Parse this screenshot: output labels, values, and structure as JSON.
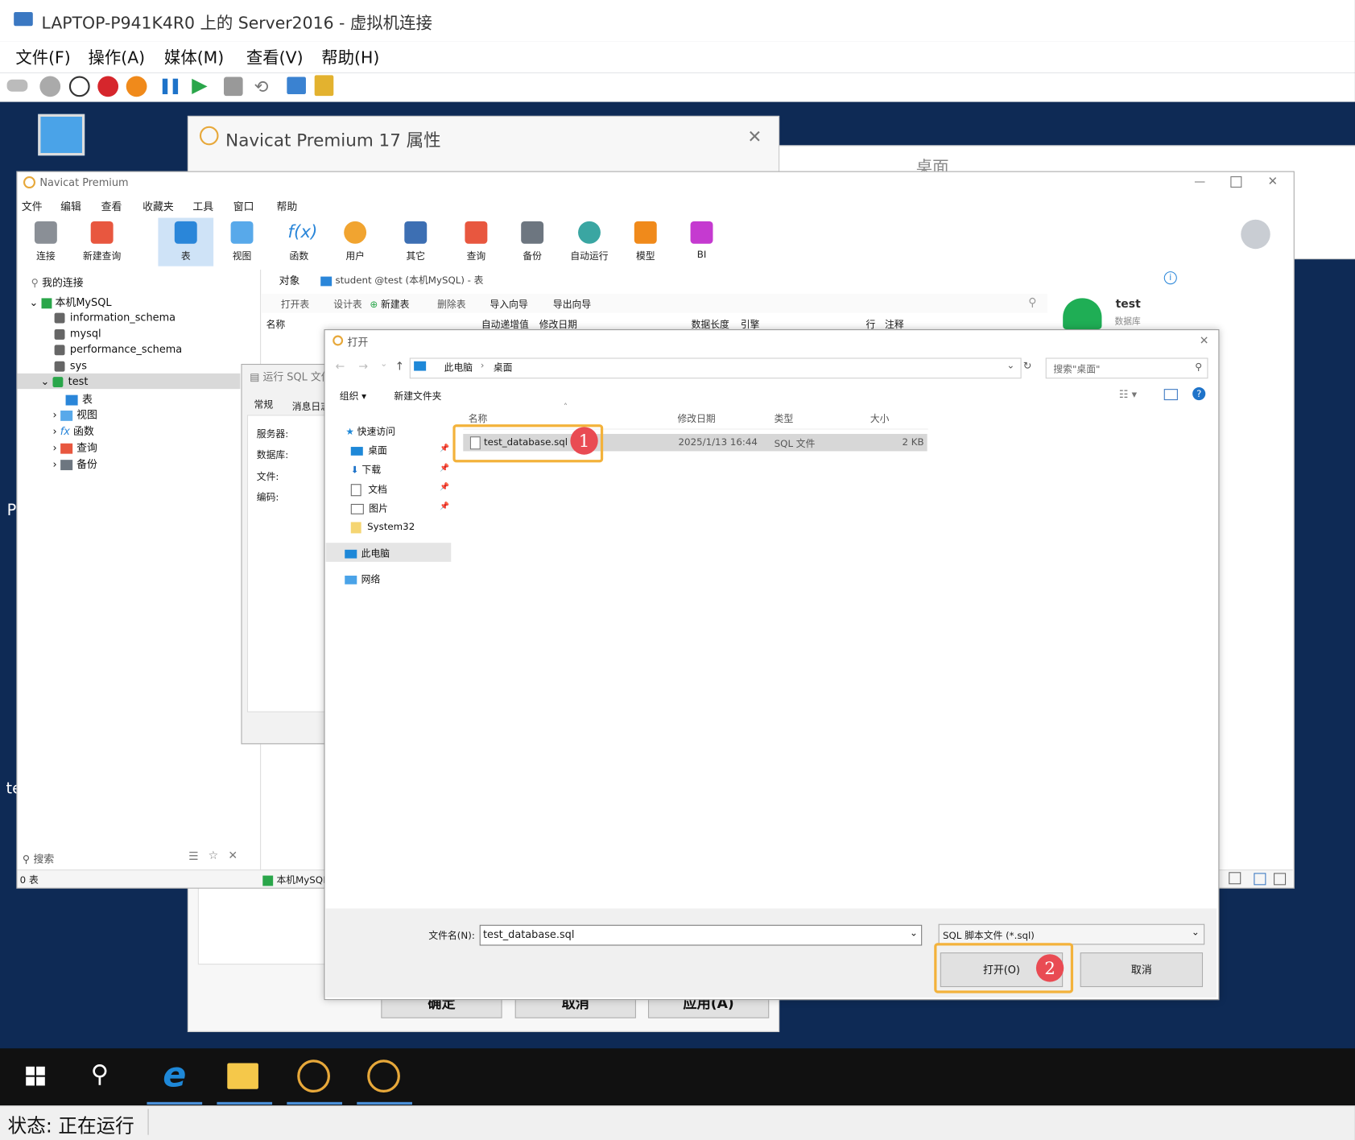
{
  "vm": {
    "title": "LAPTOP-P941K4R0 上的 Server2016 - 虚拟机连接",
    "menu": [
      "文件(F)",
      "操作(A)",
      "媒体(M)",
      "查看(V)",
      "帮助(H)"
    ],
    "status": "状态: 正在运行"
  },
  "prop_dialog": {
    "title": "Navicat Premium 17 属性",
    "buttons": [
      "确定",
      "取消",
      "应用(A)"
    ]
  },
  "explorer_bg": {
    "path_label": "桌面"
  },
  "navicat": {
    "title": "Navicat Premium",
    "menu": [
      "文件",
      "编辑",
      "查看",
      "收藏夹",
      "工具",
      "窗口",
      "帮助"
    ],
    "ribbon": [
      "连接",
      "新建查询",
      "表",
      "视图",
      "函数",
      "用户",
      "其它",
      "查询",
      "备份",
      "自动运行",
      "模型",
      "BI"
    ],
    "tree": {
      "root": "我的连接",
      "connection": "本机MySQL",
      "databases": [
        "information_schema",
        "mysql",
        "performance_schema",
        "sys",
        "test"
      ],
      "test_children": [
        "表",
        "视图",
        "函数",
        "查询",
        "备份"
      ]
    },
    "search_label": "搜索",
    "status_left": "0 表",
    "status_conn": "本机MySQL",
    "tabs": [
      "对象",
      "student @test (本机MySQL) - 表"
    ],
    "object_toolbar": [
      "打开表",
      "设计表",
      "新建表",
      "删除表",
      "导入向导",
      "导出向导"
    ],
    "columns": [
      "名称",
      "自动递增值",
      "修改日期",
      "数据长度",
      "引擎",
      "行",
      "注释"
    ],
    "info_panel": {
      "name": "test",
      "sub": "数据库"
    },
    "run_sql": {
      "title": "运行 SQL 文件",
      "tabs": [
        "常规",
        "消息日志"
      ],
      "fields": [
        "服务器:",
        "数据库:",
        "文件:",
        "编码:"
      ]
    }
  },
  "open_dialog": {
    "title": "打开",
    "breadcrumb": [
      "此电脑",
      "桌面"
    ],
    "search_placeholder": "搜索\"桌面\"",
    "toolbar": [
      "组织 ▾",
      "新建文件夹"
    ],
    "sidebar": {
      "quick_access": "快速访问",
      "items": [
        "桌面",
        "下载",
        "文档",
        "图片",
        "System32"
      ],
      "this_pc": "此电脑",
      "network": "网络"
    },
    "columns": [
      "名称",
      "修改日期",
      "类型",
      "大小"
    ],
    "files": [
      {
        "name": "test_database.sql",
        "date": "2025/1/13 16:44",
        "type": "SQL 文件",
        "size": "2 KB"
      }
    ],
    "filename_label": "文件名(N):",
    "filename_value": "test_database.sql",
    "filetype_value": "SQL 脚本文件 (*.sql)",
    "open_button": "打开(O)",
    "cancel_button": "取消",
    "badges": [
      "1",
      "2"
    ]
  },
  "colors": {
    "highlight": "#f3b23b",
    "badge": "#e94b53",
    "selection": "#cfe3f7"
  },
  "desktop_labels": [
    "P",
    "te"
  ]
}
